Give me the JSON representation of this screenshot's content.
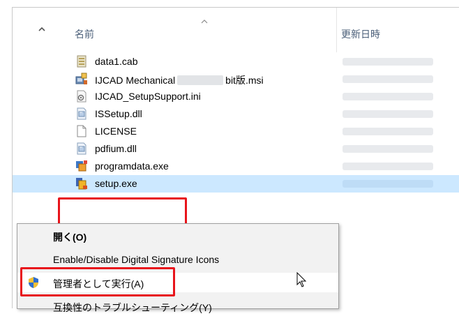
{
  "header": {
    "col_name": "名前",
    "col_date": "更新日時"
  },
  "files": [
    {
      "name": "data1.cab",
      "icon": "cabinet-file-icon"
    },
    {
      "name_pre": "IJCAD Mechanical",
      "name_post": "bit版.msi",
      "icon": "msi-installer-icon"
    },
    {
      "name": "IJCAD_SetupSupport.ini",
      "icon": "ini-settings-file-icon"
    },
    {
      "name": "ISSetup.dll",
      "icon": "dll-file-icon"
    },
    {
      "name": "LICENSE",
      "icon": "blank-file-icon"
    },
    {
      "name": "pdfium.dll",
      "icon": "dll-file-icon"
    },
    {
      "name": "programdata.exe",
      "icon": "exe-app-icon"
    },
    {
      "name": "setup.exe",
      "icon": "setup-exe-icon",
      "selected": true
    }
  ],
  "context_menu": {
    "items": [
      {
        "label": "開く(O)",
        "bold": true
      },
      {
        "label": "Enable/Disable Digital Signature Icons"
      },
      {
        "label": "管理者として実行(A)",
        "icon": "uac-shield-icon",
        "hover": true
      },
      {
        "label": "互換性のトラブルシューティング(Y)"
      }
    ]
  },
  "colors": {
    "selection": "#cce8ff",
    "highlight_box": "#e8141b",
    "menu_bg": "#f2f2f2",
    "header_text": "#4c607a"
  }
}
